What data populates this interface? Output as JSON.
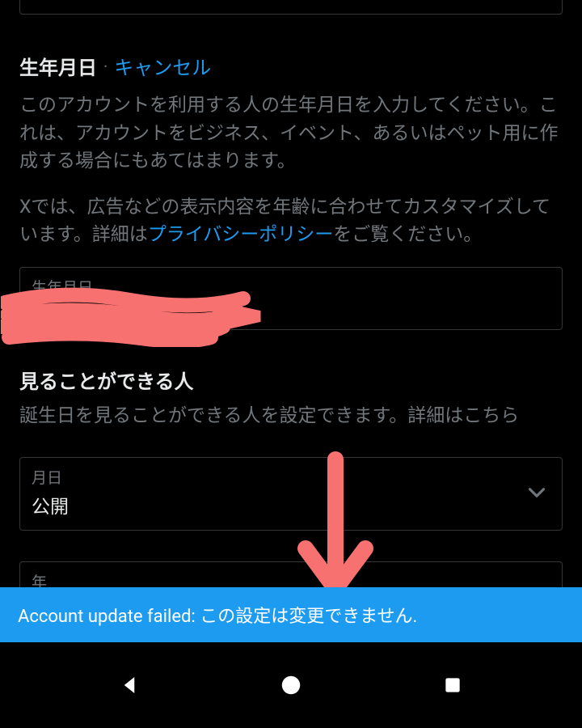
{
  "birthdate": {
    "title": "生年月日",
    "separator": "·",
    "cancel": "キャンセル",
    "description1": "このアカウントを利用する人の生年月日を入力してください。これは、アカウントをビジネス、イベント、あるいはペット用に作成する場合にもあてはまります。",
    "description2_prefix": "Xでは、広告などの表示内容を年齢に合わせてカスタマイズしています。詳細は",
    "description2_link": "プライバシーポリシー",
    "description2_suffix": "をご覧ください。",
    "field_label": "生年月日",
    "field_value": ""
  },
  "visibility": {
    "title": "見ることができる人",
    "description_prefix": "誕生日を見ることができる人を設定できます。",
    "description_link": "詳細はこちら",
    "month_day": {
      "label": "月日",
      "value": "公開"
    },
    "year": {
      "label": "年"
    }
  },
  "toast": {
    "message": "Account update failed: この設定は変更できません."
  },
  "colors": {
    "accent": "#1d9bf0",
    "redaction": "#f87171"
  }
}
